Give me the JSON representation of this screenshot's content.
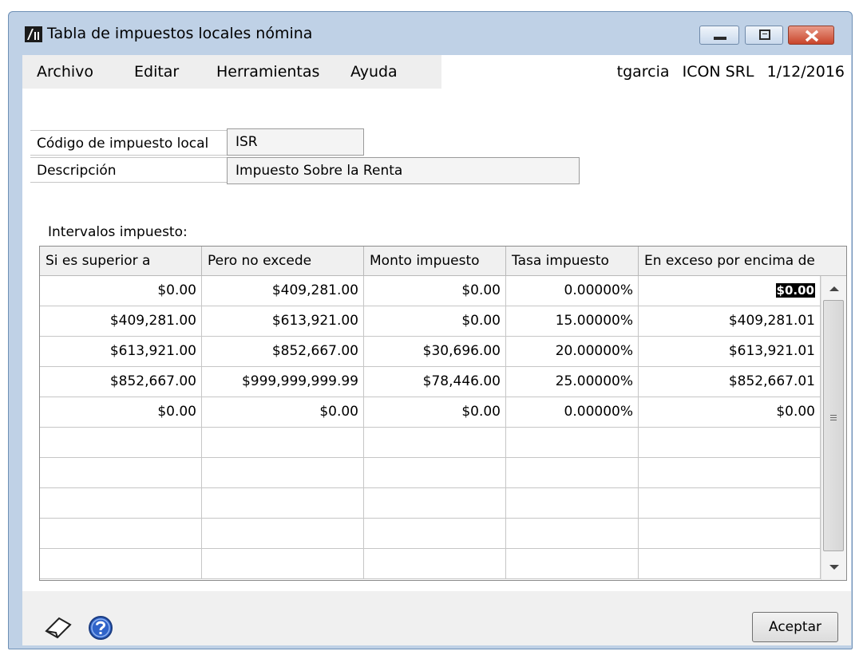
{
  "window": {
    "title": "Tabla de impuestos locales nómina"
  },
  "menu": {
    "items": [
      "Archivo",
      "Editar",
      "Herramientas",
      "Ayuda"
    ],
    "user": "tgarcia",
    "company": "ICON SRL",
    "date": "1/12/2016"
  },
  "form": {
    "code_label": "Código de impuesto local",
    "code_value": "ISR",
    "description_label": "Descripción",
    "description_value": "Impuesto Sobre la Renta"
  },
  "grid": {
    "title": "Intervalos impuesto:",
    "columns": [
      "Si es superior a",
      "Pero no excede",
      "Monto impuesto",
      "Tasa impuesto",
      "En exceso por encima de"
    ],
    "rows": [
      [
        "$0.00",
        "$409,281.00",
        "$0.00",
        "0.00000%",
        "$0.00"
      ],
      [
        "$409,281.00",
        "$613,921.00",
        "$0.00",
        "15.00000%",
        "$409,281.01"
      ],
      [
        "$613,921.00",
        "$852,667.00",
        "$30,696.00",
        "20.00000%",
        "$613,921.01"
      ],
      [
        "$852,667.00",
        "$999,999,999.99",
        "$78,446.00",
        "25.00000%",
        "$852,667.01"
      ],
      [
        "$0.00",
        "$0.00",
        "$0.00",
        "0.00000%",
        "$0.00"
      ]
    ],
    "empty_rows": 5
  },
  "footer": {
    "ok_label": "Aceptar",
    "icons": [
      "note-icon",
      "help-icon"
    ]
  },
  "colors": {
    "window_frame": "#bfd1e6",
    "close_button": "#c9452b",
    "selection": "#000000"
  }
}
